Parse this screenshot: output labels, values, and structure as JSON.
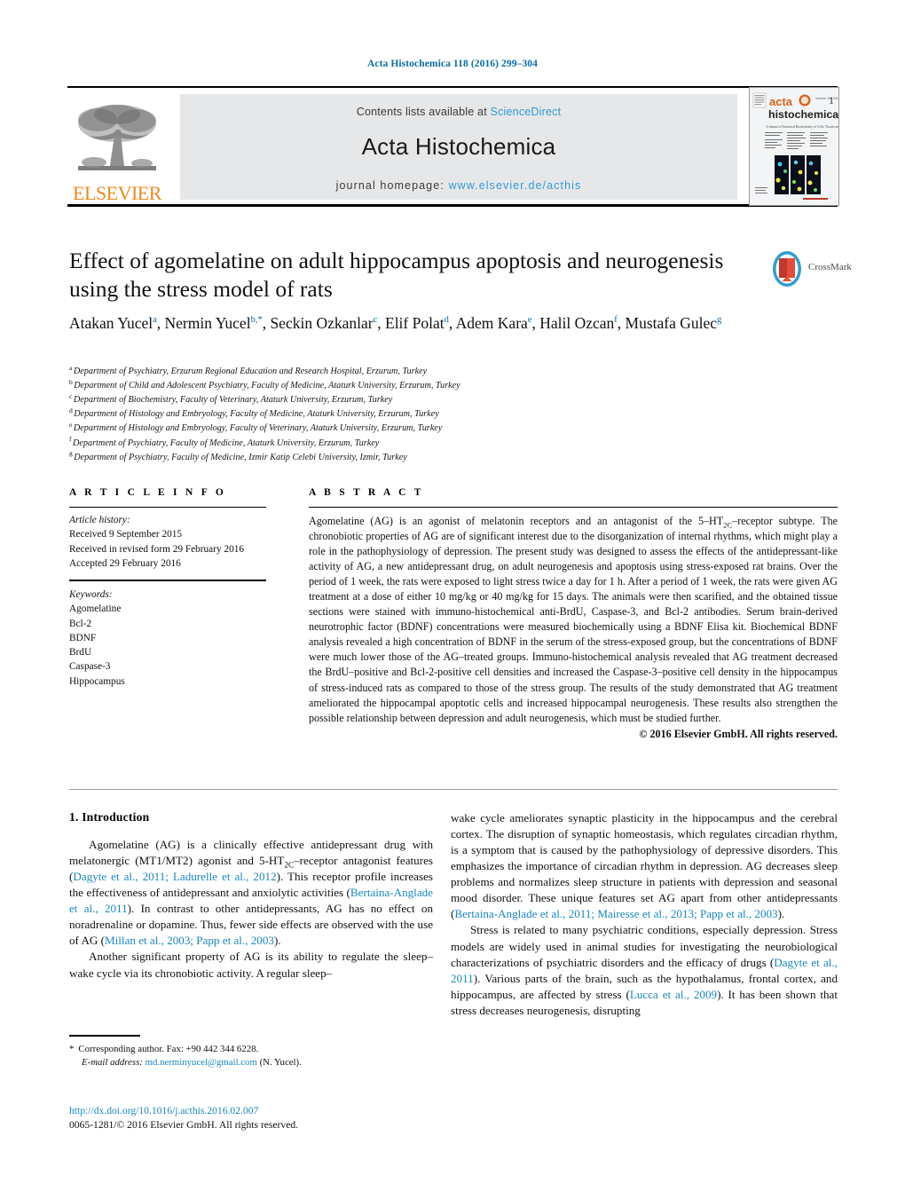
{
  "running_head": "Acta Histochemica 118 (2016) 299–304",
  "masthead": {
    "contents_prefix": "Contents lists available at ",
    "contents_link": "ScienceDirect",
    "journal_name": "Acta Histochemica",
    "homepage_prefix": "journal homepage: ",
    "homepage_url": "www.elsevier.de/acthis",
    "publisher_wordmark": "ELSEVIER",
    "cover": {
      "brand_line1": "acta",
      "brand_line2": "histochemica",
      "issue_number": "1",
      "issue_meta": "Volume 118 · 2016",
      "subtitle": "Journal of Structural Biochemistry of Cells, Tissues and Organs"
    }
  },
  "crossmark": {
    "label": "CrossMark"
  },
  "title": "Effect of agomelatine on adult hippocampus apoptosis and neurogenesis using the stress model of rats",
  "authors": [
    {
      "name": "Atakan Yucel",
      "marks": "a"
    },
    {
      "name": "Nermin Yucel",
      "marks": "b,*"
    },
    {
      "name": "Seckin Ozkanlar",
      "marks": "c"
    },
    {
      "name": "Elif Polat",
      "marks": "d"
    },
    {
      "name": "Adem Kara",
      "marks": "e"
    },
    {
      "name": "Halil Ozcan",
      "marks": "f"
    },
    {
      "name": "Mustafa Gulec",
      "marks": "g"
    }
  ],
  "affiliations": [
    {
      "mark": "a",
      "text": "Department of Psychiatry, Erzurum Regional Education and Research Hospital, Erzurum, Turkey"
    },
    {
      "mark": "b",
      "text": "Department of Child and Adolescent Psychiatry, Faculty of Medicine, Ataturk University, Erzurum, Turkey"
    },
    {
      "mark": "c",
      "text": "Department of Biochemistry, Faculty of Veterinary, Ataturk University, Erzurum, Turkey"
    },
    {
      "mark": "d",
      "text": "Department of Histology and Embryology, Faculty of Medicine, Ataturk University, Erzurum, Turkey"
    },
    {
      "mark": "e",
      "text": "Department of Histology and Embryology, Faculty of Veterinary, Ataturk University, Erzurum, Turkey"
    },
    {
      "mark": "f",
      "text": "Department of Psychiatry, Faculty of Medicine, Ataturk University, Erzurum, Turkey"
    },
    {
      "mark": "g",
      "text": "Department of Psychiatry, Faculty of Medicine, Izmir Katip Celebi University, Izmir, Turkey"
    }
  ],
  "article_info": {
    "heading": "A R T I C L E   I N F O",
    "history_label": "Article history:",
    "history": [
      "Received 9 September 2015",
      "Received in revised form 29 February 2016",
      "Accepted 29 February 2016"
    ],
    "keywords_label": "Keywords:",
    "keywords": [
      "Agomelatine",
      "Bcl-2",
      "BDNF",
      "BrdU",
      "Caspase-3",
      "Hippocampus"
    ]
  },
  "abstract": {
    "heading": "A B S T R A C T",
    "text_part1": "Agomelatine (AG) is an agonist of melatonin receptors and an antagonist of the 5–HT",
    "subscript": "2C",
    "text_part2": "–receptor subtype. The chronobiotic properties of AG are of significant interest due to the disorganization of internal rhythms, which might play a role in the pathophysiology of depression. The present study was designed to assess the effects of the antidepressant-like activity of AG, a new antidepressant drug, on adult neurogenesis and apoptosis using stress-exposed rat brains. Over the period of 1 week, the rats were exposed to light stress twice a day for 1 h. After a period of 1 week, the rats were given AG treatment at a dose of either 10 mg/kg or 40 mg/kg for 15 days. The animals were then scarified, and the obtained tissue sections were stained with immuno-histochemical anti-BrdU, Caspase-3, and Bcl-2 antibodies. Serum brain-derived neurotrophic factor (BDNF) concentrations were measured biochemically using a BDNF Elisa kit. Biochemical BDNF analysis revealed a high concentration of BDNF in the serum of the stress-exposed group, but the concentrations of BDNF were much lower those of the AG–treated groups. Immuno-histochemical analysis revealed that AG treatment decreased the BrdU–positive and Bcl-2-positive cell densities and increased the Caspase-3–positive cell density in the hippocampus of stress-induced rats as compared to those of the stress group. The results of the study demonstrated that AG treatment ameliorated the hippocampal apoptotic cells and increased hippocampal neurogenesis. These results also strengthen the possible relationship between depression and adult neurogenesis, which must be studied further.",
    "copyright": "© 2016 Elsevier GmbH. All rights reserved."
  },
  "introduction": {
    "heading": "1.  Introduction",
    "p1_a": "Agomelatine (AG) is a clinically effective antidepressant drug with melatonergic (MT1/MT2) agonist and 5-HT",
    "p1_sub": "2C",
    "p1_b": "–receptor antagonist features (",
    "p1_cite1": "Dagyte et al., 2011; Ladurelle et al., 2012",
    "p1_c": "). This receptor profile increases the effectiveness of antidepressant and anxiolytic activities (",
    "p1_cite2": "Bertaina-Anglade et al., 2011",
    "p1_d": "). In contrast to other antidepressants, AG has no effect on noradrenaline or dopamine. Thus, fewer side effects are observed with the use of AG (",
    "p1_cite3": "Millan et al., 2003; Papp et al., 2003",
    "p1_e": ").",
    "p2": "Another significant property of AG is its ability to regulate the sleep–wake cycle via its chronobiotic activity. A regular sleep–",
    "p2_cont_a": "wake cycle ameliorates synaptic plasticity in the hippocampus and the cerebral cortex. The disruption of synaptic homeostasis, which regulates circadian rhythm, is a symptom that is caused by the pathophysiology of depressive disorders. This emphasizes the importance of circadian rhythm in depression. AG decreases sleep problems and normalizes sleep structure in patients with depression and seasonal mood disorder. These unique features set AG apart from other antidepressants (",
    "p2_cite": "Bertaina-Anglade et al., 2011; Mairesse et al., 2013; Papp et al., 2003",
    "p2_cont_b": ").",
    "p3_a": "Stress is related to many psychiatric conditions, especially depression. Stress models are widely used in animal studies for investigating the neurobiological characterizations of psychiatric disorders and the efficacy of drugs (",
    "p3_cite1": "Dagyte et al., 2011",
    "p3_b": "). Various parts of the brain, such as the hypothalamus, frontal cortex, and hippocampus, are affected by stress (",
    "p3_cite2": "Lucca et al., 2009",
    "p3_c": "). It has been shown that stress decreases neurogenesis, disrupting"
  },
  "footnote": {
    "star": "*",
    "corresponding": "Corresponding author. Fax: +90 442 344 6228.",
    "email_label": "E-mail address:",
    "email": "md.nerminyucel@gmail.com",
    "email_owner": "(N. Yucel)."
  },
  "doi_footer": {
    "doi_url": "http://dx.doi.org/10.1016/j.acthis.2016.02.007",
    "issn_line": "0065-1281/© 2016 Elsevier GmbH. All rights reserved."
  },
  "colors": {
    "link_blue": "#1a87bd",
    "header_blue": "#0b6ca8",
    "sciencedirect_blue": "#2f9bd4",
    "elsevier_orange": "#eb8a1e",
    "band_gray": "#e6e7e8"
  }
}
